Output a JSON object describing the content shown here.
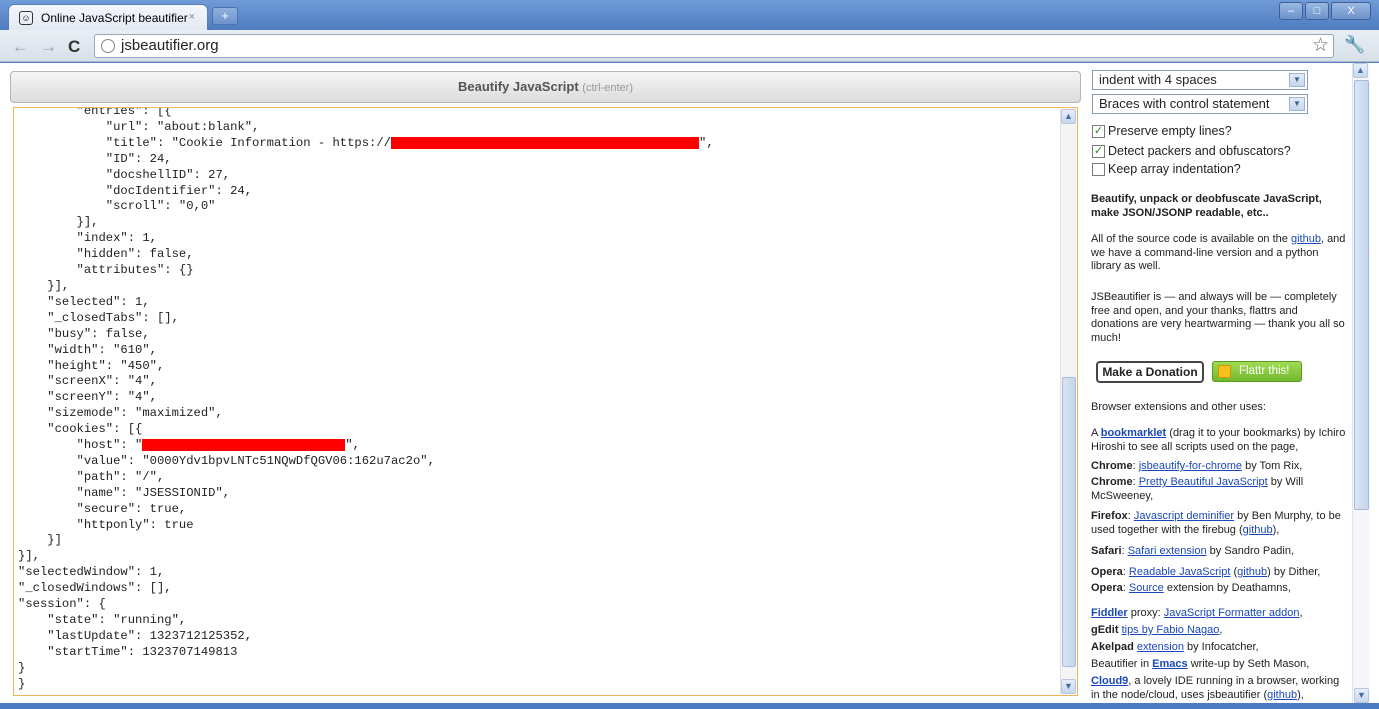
{
  "browser": {
    "tab_title": "Online JavaScript beautifier",
    "tab_close": "×",
    "new_tab": "+",
    "url": "jsbeautifier.org",
    "back": "←",
    "forward": "→",
    "reload": "C",
    "star": "☆",
    "wrench": "🔧",
    "minimize": "–",
    "maximize": "□",
    "close": "X"
  },
  "main": {
    "beautify_label": "Beautify JavaScript",
    "beautify_hint": "(ctrl-enter)",
    "code_lines": [
      "        \"entries\": [{",
      "            \"url\": \"about:blank\",",
      "            \"title\": \"Cookie Information - https://",
      "\",",
      "            \"ID\": 24,",
      "            \"docshellID\": 27,",
      "            \"docIdentifier\": 24,",
      "            \"scroll\": \"0,0\"",
      "        }],",
      "        \"index\": 1,",
      "        \"hidden\": false,",
      "        \"attributes\": {}",
      "    }],",
      "    \"selected\": 1,",
      "    \"_closedTabs\": [],",
      "    \"busy\": false,",
      "    \"width\": \"610\",",
      "    \"height\": \"450\",",
      "    \"screenX\": \"4\",",
      "    \"screenY\": \"4\",",
      "    \"sizemode\": \"maximized\",",
      "    \"cookies\": [{",
      "        \"host\": \"",
      "\",",
      "        \"value\": \"0000Ydv1bpvLNTc51NQwDfQGV06:162u7ac2o\",",
      "        \"path\": \"/\",",
      "        \"name\": \"JSESSIONID\",",
      "        \"secure\": true,",
      "        \"httponly\": true",
      "    }]",
      "}],",
      "\"selectedWindow\": 1,",
      "\"_closedWindows\": [],",
      "\"session\": {",
      "    \"state\": \"running\",",
      "    \"lastUpdate\": 1323712125352,",
      "    \"startTime\": 1323707149813",
      "}",
      "}"
    ]
  },
  "sidebar": {
    "indent_select": "indent with 4 spaces",
    "braces_select": "Braces with control statement",
    "opt_empty_lines": "Preserve empty lines?",
    "opt_packers": "Detect packers and obfuscators?",
    "opt_array_indent": "Keep array indentation?",
    "check_mark": "✓",
    "headline": "Beautify, unpack or deobfuscate JavaScript, make JSON/JSONP readable, etc..",
    "source_pre": "All of the source code is available on the ",
    "source_link": "github",
    "source_post": ", and we have a command-line version and a python library as well.",
    "free_text": "JSBeautifier is — and always will be — completely free and open, and your thanks, flattrs and donations are very heartwarming — thank you all so much!",
    "donate_button": "Make a Donation",
    "flattr_button": "Flattr this!",
    "ext_heading": "Browser extensions and other uses:",
    "bm_pre": "A ",
    "bm_link": "bookmarklet",
    "bm_post": " (drag it to your bookmarks) by Ichiro Hiroshi to see all scripts used on the page,",
    "chrome1_label": "Chrome",
    "chrome1_link": "jsbeautify-for-chrome",
    "chrome1_post": " by Tom Rix,",
    "chrome2_label": "Chrome",
    "chrome2_link": "Pretty Beautiful JavaScript",
    "chrome2_post": " by Will McSweeney,",
    "firefox_label": "Firefox",
    "firefox_link": "Javascript deminifier",
    "firefox_post": " by Ben Murphy, to be used together with the firebug (",
    "firefox_gh": "github",
    "safari_label": "Safari",
    "safari_link": "Safari extension",
    "safari_post": " by Sandro Padin,",
    "opera1_label": "Opera",
    "opera1_link": "Readable JavaScript",
    "opera1_gh": "github",
    "opera1_post": ") by Dither,",
    "opera2_label": "Opera",
    "opera2_link": "Source",
    "opera2_post": " extension by Deathamns,",
    "fiddler_link": "Fiddler",
    "fiddler_mid": " proxy: ",
    "fiddler_link2": "JavaScript Formatter addon",
    "gedit_label": "gEdit",
    "gedit_link": "tips by Fabio Nagao",
    "akelpad_label": "Akelpad",
    "akelpad_link": "extension",
    "akelpad_post": " by Infocatcher,",
    "emacs_pre": "Beautifier in ",
    "emacs_link": "Emacs",
    "emacs_post": " write-up by Seth Mason,",
    "cloud9_link": "Cloud9",
    "cloud9_post": ", a lovely IDE running in a browser, working in the node/cloud, uses jsbeautifier (",
    "cloud9_gh": "github"
  }
}
